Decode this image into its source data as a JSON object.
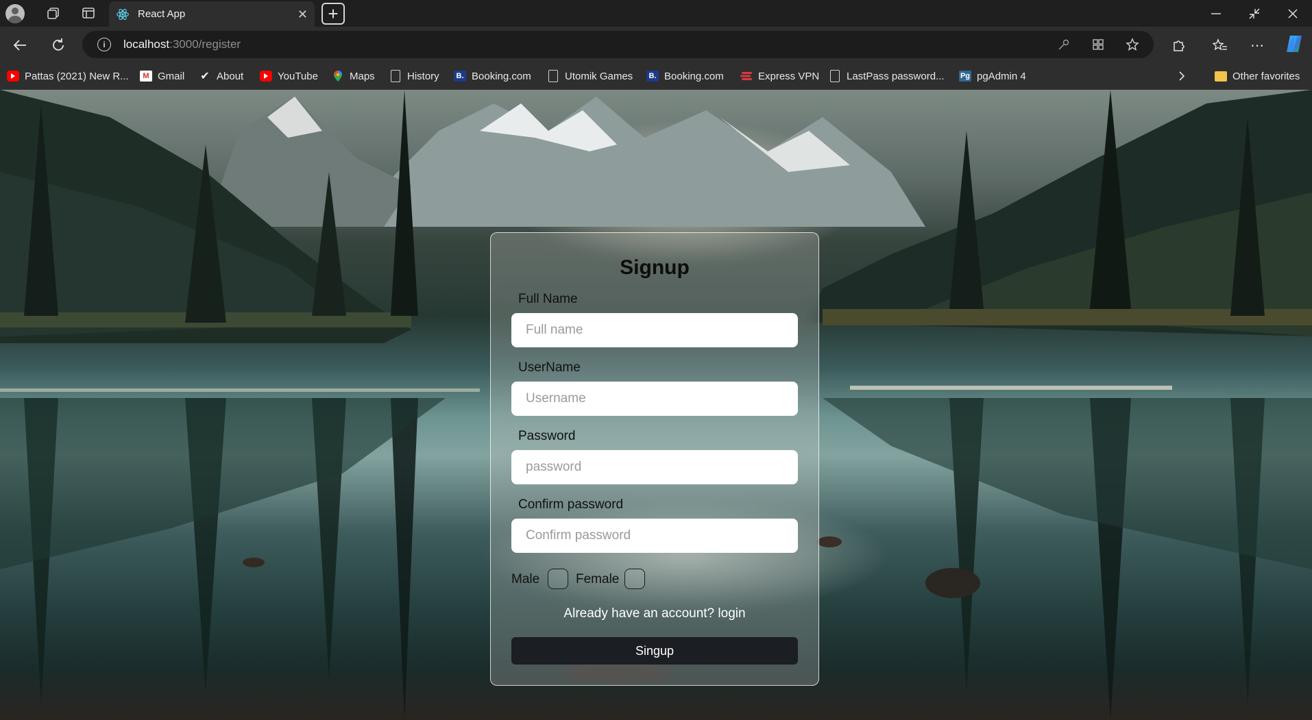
{
  "browser": {
    "tab": {
      "title": "React App"
    },
    "address_bar": {
      "url_host": "localhost",
      "url_rest": ":3000/register"
    },
    "bookmarks": [
      {
        "label": "Pattas (2021) New R...",
        "icon": "youtube-icon"
      },
      {
        "label": "Gmail",
        "icon": "gmail-icon"
      },
      {
        "label": "About",
        "icon": "checkmark-icon"
      },
      {
        "label": "YouTube",
        "icon": "youtube-icon"
      },
      {
        "label": "Maps",
        "icon": "maps-pin-icon"
      },
      {
        "label": "History",
        "icon": "page-icon"
      },
      {
        "label": "Booking.com",
        "icon": "booking-icon"
      },
      {
        "label": "Utomik Games",
        "icon": "page-icon"
      },
      {
        "label": "Booking.com",
        "icon": "booking-icon"
      },
      {
        "label": "Express VPN",
        "icon": "expressvpn-icon"
      },
      {
        "label": "LastPass password...",
        "icon": "page-icon"
      },
      {
        "label": "pgAdmin 4",
        "icon": "pgadmin-icon"
      }
    ],
    "other_favorites": "Other favorites",
    "booking_glyph": "B.",
    "pgadmin_glyph": "Pg",
    "gmail_glyph": "M",
    "about_glyph": "✔"
  },
  "form": {
    "title": "Signup",
    "fields": [
      {
        "label": "Full Name",
        "placeholder": "Full name"
      },
      {
        "label": "UserName",
        "placeholder": "Username"
      },
      {
        "label": "Password",
        "placeholder": "password"
      },
      {
        "label": "Confirm password",
        "placeholder": "Confirm password"
      }
    ],
    "gender": {
      "male": "Male",
      "female": "Female"
    },
    "login_prompt": "Already have an account? login",
    "submit_label": "Singup"
  },
  "colors": {
    "card_border": "#ffffff",
    "button_bg": "#1b1e23",
    "browser_bg": "#2e2e2e"
  }
}
